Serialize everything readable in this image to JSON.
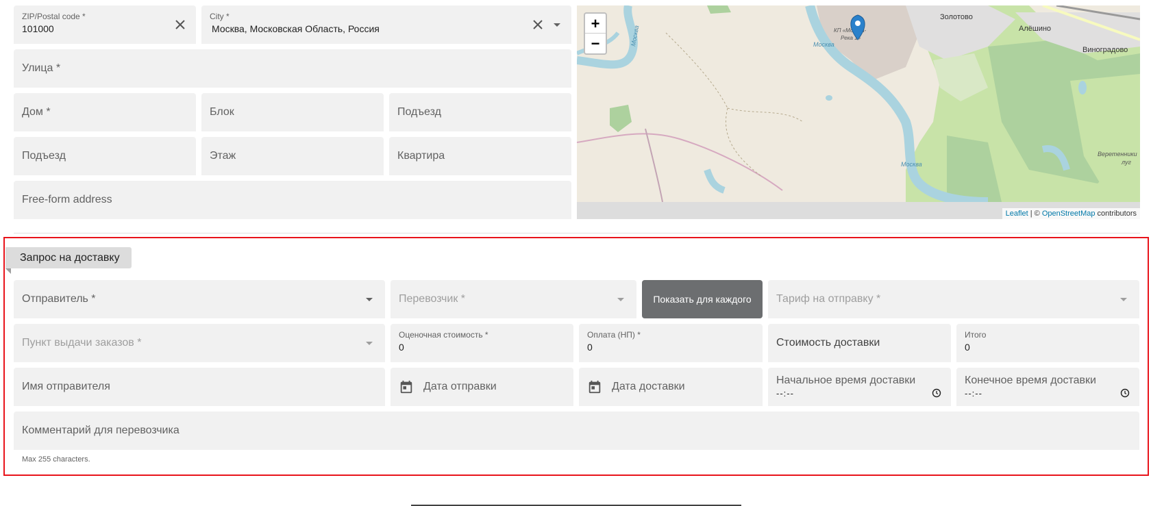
{
  "address": {
    "zip": {
      "label": "ZIP/Postal code *",
      "value": "101000"
    },
    "city": {
      "label": "City *",
      "value": "Москва, Московская Область, Россия"
    },
    "street": "Улица *",
    "house": "Дом *",
    "block": "Блок",
    "entrance_top": "Подъезд",
    "entrance": "Подъезд",
    "floor": "Этаж",
    "apartment": "Квартира",
    "freeform": "Free-form address"
  },
  "map": {
    "zoom_in": "+",
    "zoom_out": "−",
    "attribution_leaflet": "Leaflet",
    "attribution_sep": " | © ",
    "attribution_osm": "OpenStreetMap",
    "attribution_rest": " contributors",
    "labels": {
      "zolotovo": "Золотово",
      "aleshino": "Алёшино",
      "vinogradovo": "Виноградово",
      "moskva1": "Москва",
      "moskva2": "Москва",
      "moskva3": "Москва",
      "kp": "КП «Москва-",
      "kp2": "Река 1»",
      "veretenniki": "Веретенники",
      "lug": "луг"
    }
  },
  "delivery": {
    "tab_label": "Запрос на доставку",
    "sender": "Отправитель *",
    "carrier": "Перевозчик *",
    "show_each_button": "Показать для каждого",
    "tariff": "Тариф на отправку *",
    "pickup_point": "Пункт выдачи заказов *",
    "estimated_cost": {
      "label": "Оценочная стоимость *",
      "value": "0"
    },
    "payment": {
      "label": "Оплата (НП) *",
      "value": "0"
    },
    "delivery_cost": "Стоимость доставки",
    "total": {
      "label": "Итого",
      "value": "0"
    },
    "sender_name": "Имя отправителя",
    "ship_date": "Дата отправки",
    "delivery_date": "Дата доставки",
    "start_time": {
      "label": "Начальное время доставки",
      "value": "--:--"
    },
    "end_time": {
      "label": "Конечное время доставки",
      "value": "--:--"
    },
    "comment": "Комментарий для перевозчика",
    "hint": "Max 255 characters."
  }
}
